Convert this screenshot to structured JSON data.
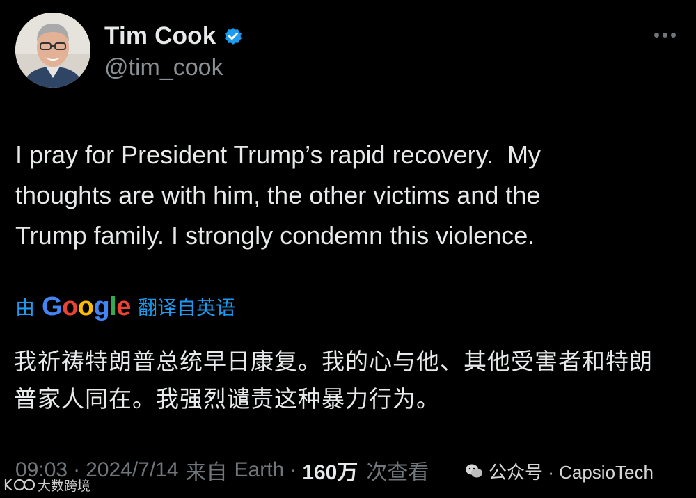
{
  "author": {
    "display_name": "Tim Cook",
    "handle": "@tim_cook",
    "verified": true,
    "avatar_icon": "profile-photo"
  },
  "tweet": {
    "text": "I pray for President Trump’s rapid recovery.  My\nthoughts are with him, the other victims and the\nTrump family. I strongly condemn this violence."
  },
  "translation": {
    "prefix": "由",
    "provider_letters": [
      "G",
      "o",
      "o",
      "g",
      "l",
      "e"
    ],
    "suffix": "翻译自英语",
    "text": "我祈祷特朗普总统早日康复。我的心与他、其他受害者和特朗普家人同在。我强烈谴责这种暴力行为。"
  },
  "meta": {
    "time": "09:03",
    "separator": "·",
    "date": "2024/7/14",
    "source_prefix": "来自",
    "source": "Earth",
    "views_count": "160万",
    "views_label": "次查看"
  },
  "watermarks": {
    "right_label": "公众号 · CapsioTech",
    "left_label": "大数跨境"
  },
  "colors": {
    "background": "#000000",
    "primary_text": "#e7e9ea",
    "secondary_text": "#71767b",
    "link_blue": "#1d9bf0",
    "verified_blue": "#1d9bf0"
  }
}
